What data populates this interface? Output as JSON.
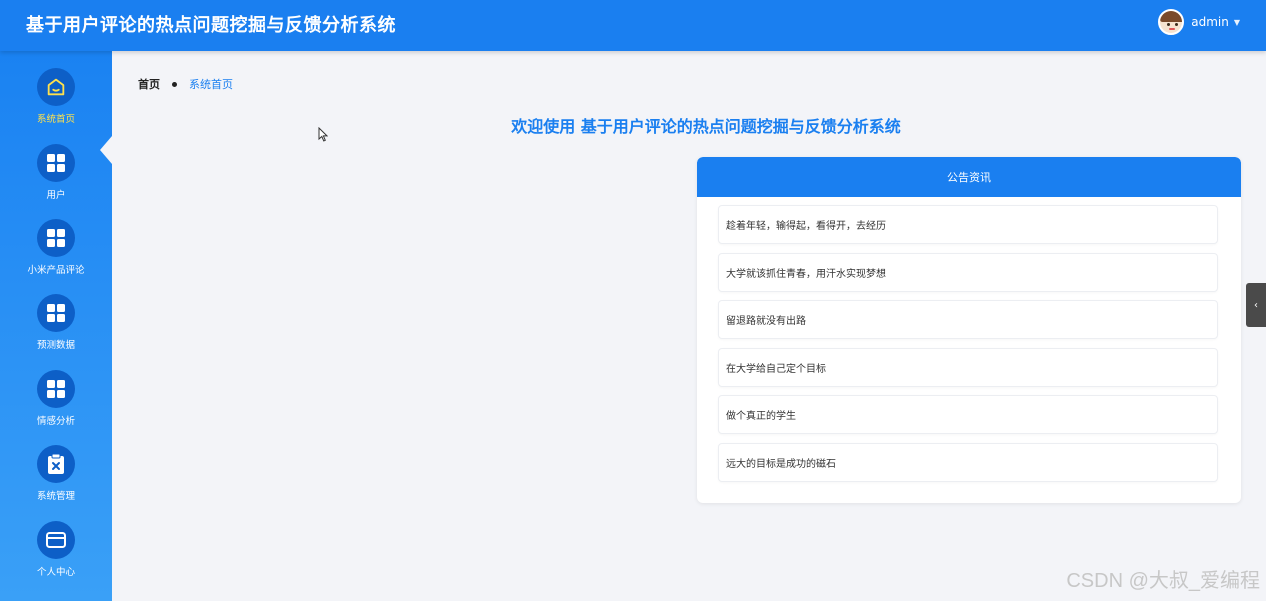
{
  "header": {
    "app_title": "基于用户评论的热点问题挖掘与反馈分析系统",
    "username": "admin",
    "caret": "▼"
  },
  "sidebar": {
    "items": [
      {
        "label": "系统首页",
        "icon": "home-icon",
        "active": true
      },
      {
        "label": "用户",
        "icon": "grid-icon"
      },
      {
        "label": "小米产品评论",
        "icon": "grid-icon"
      },
      {
        "label": "预测数据",
        "icon": "grid-icon"
      },
      {
        "label": "情感分析",
        "icon": "grid-icon"
      },
      {
        "label": "系统管理",
        "icon": "clipboard-x-icon"
      },
      {
        "label": "个人中心",
        "icon": "card-icon"
      }
    ]
  },
  "breadcrumb": {
    "home": "首页",
    "current": "系统首页"
  },
  "main": {
    "welcome_text": "欢迎使用 基于用户评论的热点问题挖掘与反馈分析系统"
  },
  "notice": {
    "title": "公告资讯",
    "items": [
      "趁着年轻，输得起，看得开，去经历",
      "大学就该抓住青春，用汗水实现梦想",
      "留退路就没有出路",
      "在大学给自己定个目标",
      "做个真正的学生",
      "远大的目标是成功的磁石"
    ]
  },
  "right_toggle": "‹",
  "watermark": "CSDN @大叔_爱编程",
  "colors": {
    "primary": "#1a7ff0",
    "sidebar_icon_bg": "#0d5fc7",
    "active_label": "#ffe14d",
    "background": "#f3f4f8"
  }
}
